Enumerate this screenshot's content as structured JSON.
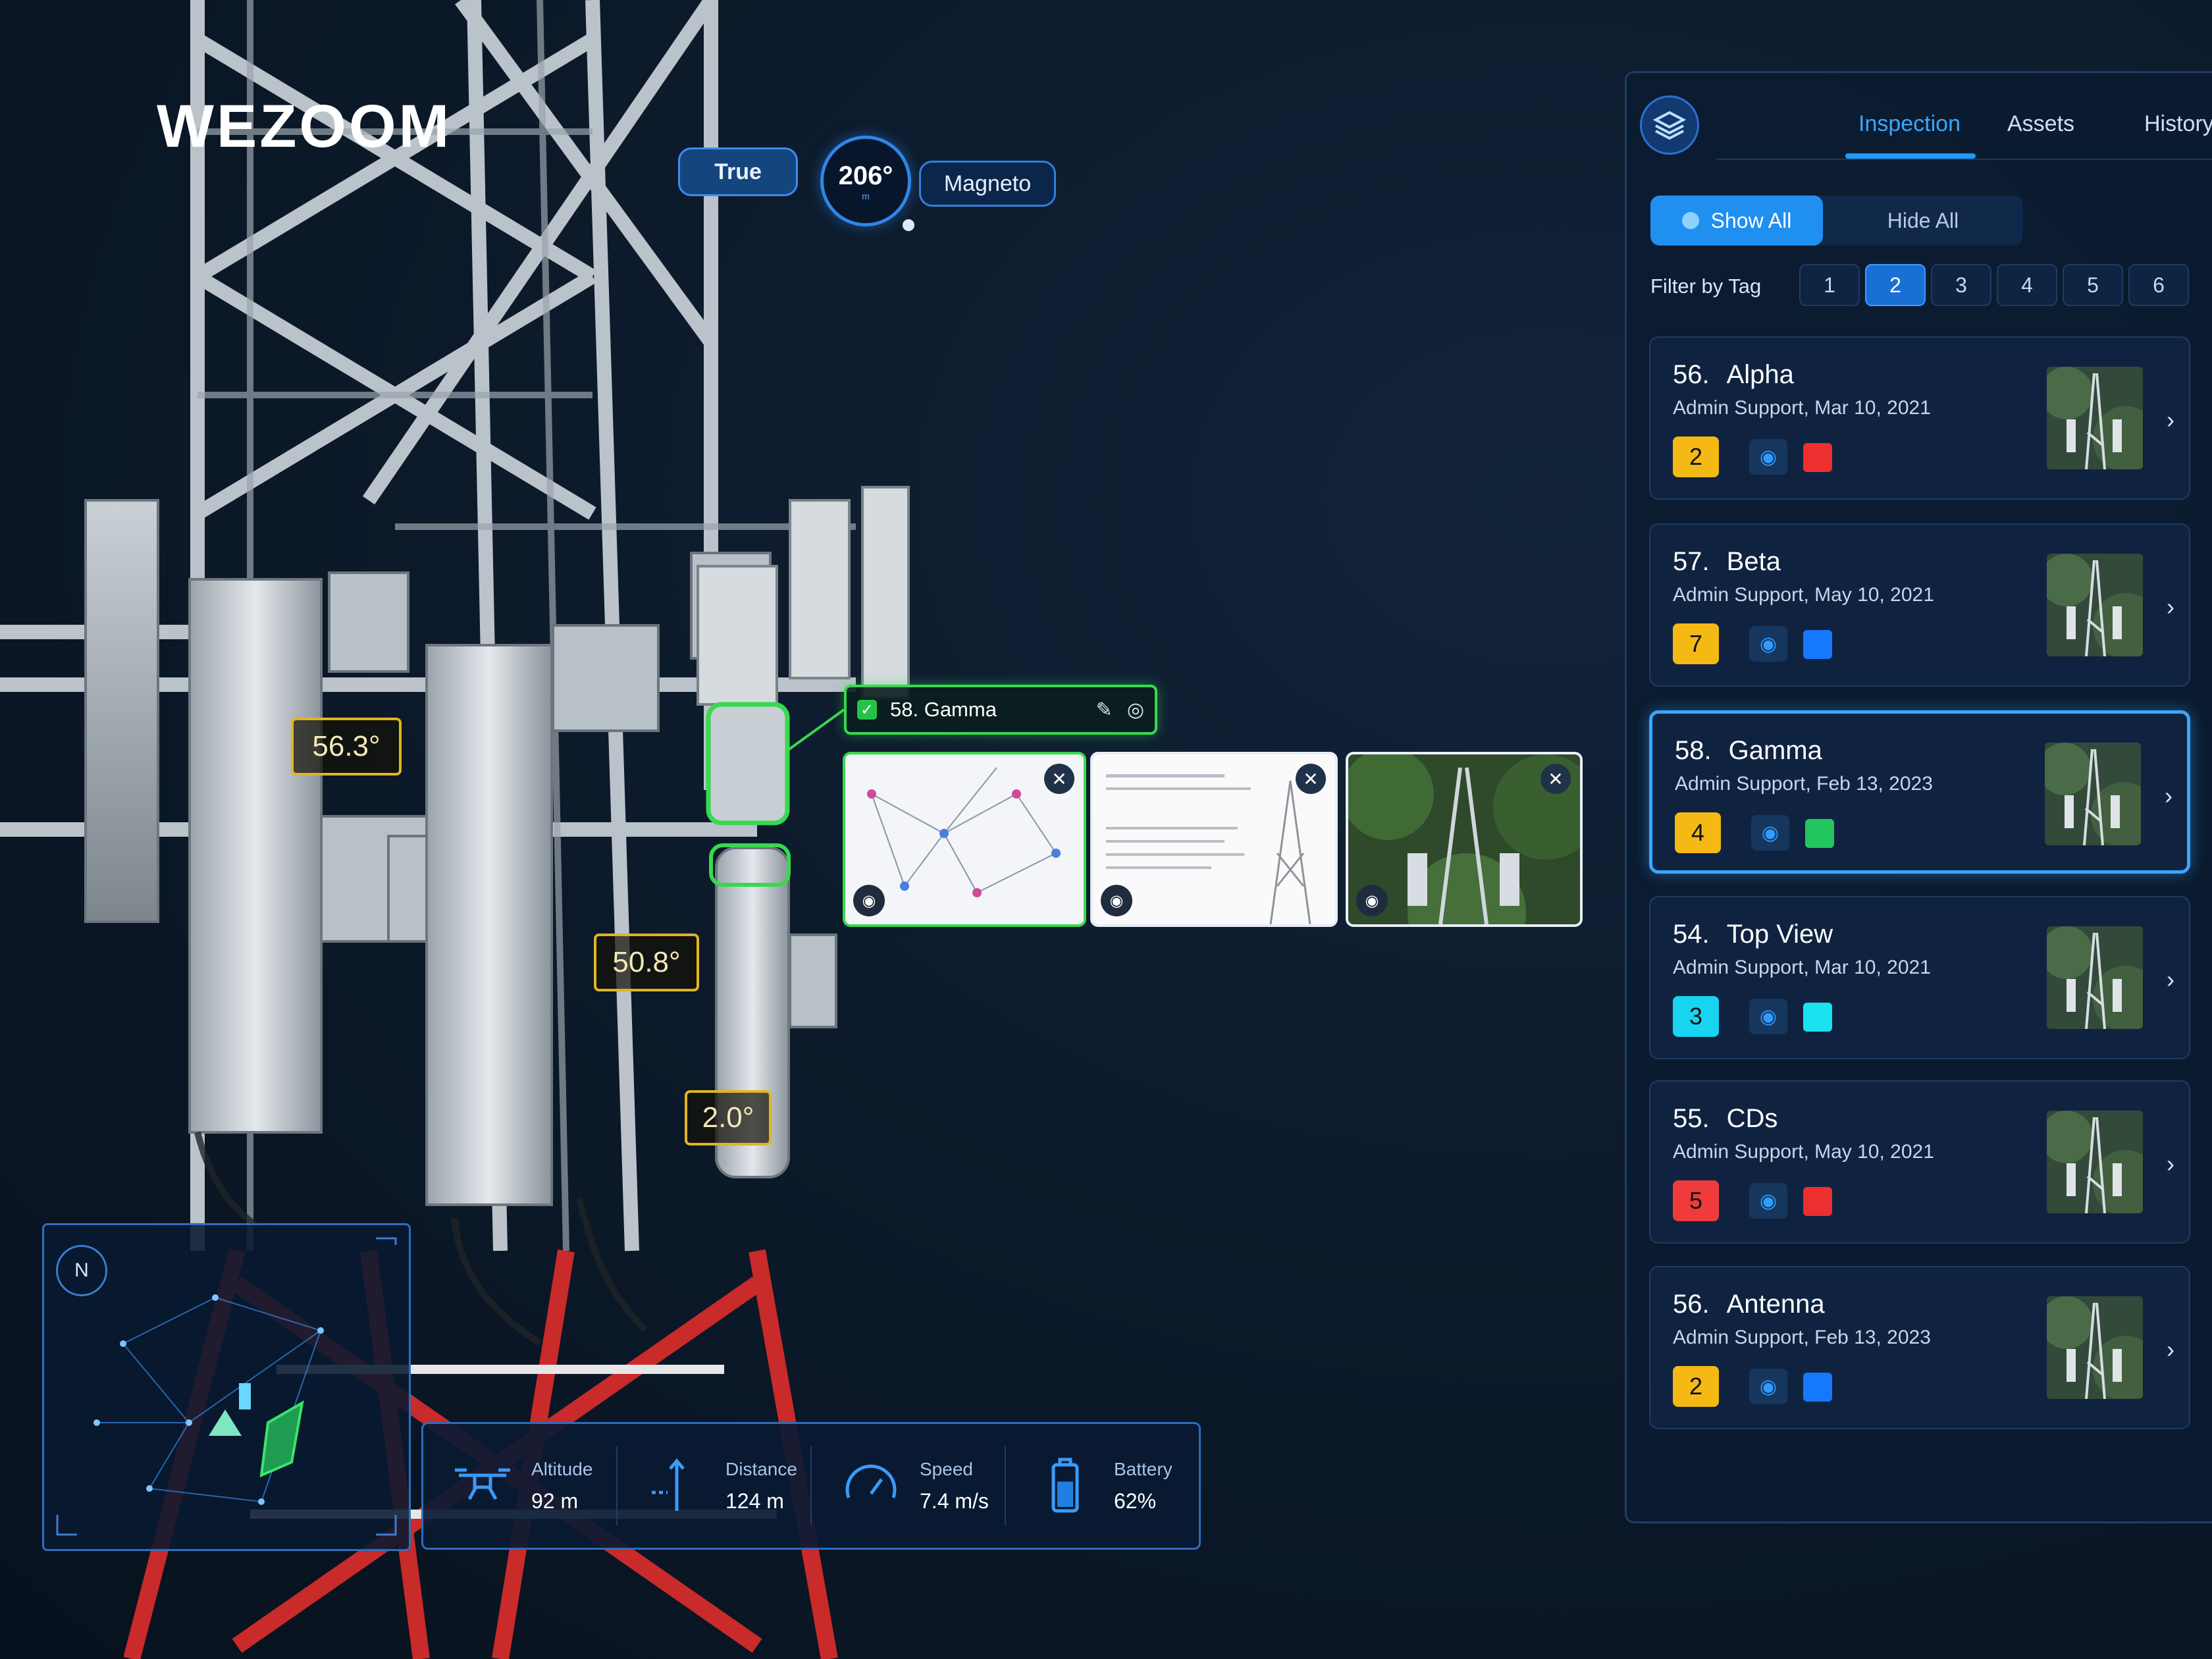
{
  "brand": {
    "logo": "WEZOOM"
  },
  "compass": {
    "true_label": "True",
    "heading": "206°",
    "unit": "m",
    "magneto_label": "Magneto"
  },
  "angles": [
    "56.3°",
    "50.8°",
    "2.0°"
  ],
  "selected_tag": {
    "label": "58. Gamma"
  },
  "minimap": {
    "north": "N"
  },
  "telemetry": [
    {
      "label": "Altitude",
      "value": "92 m",
      "icon": "drone-icon"
    },
    {
      "label": "Distance",
      "value": "124 m",
      "icon": "distance-icon"
    },
    {
      "label": "Speed",
      "value": "7.4 m/s",
      "icon": "speedometer-icon"
    },
    {
      "label": "Battery",
      "value": "62%",
      "icon": "battery-icon",
      "level": 0.62
    }
  ],
  "panel": {
    "tabs": [
      "Inspection",
      "Assets",
      "History"
    ],
    "active_tab": "Inspection",
    "show_all": "Show All",
    "hide_all": "Hide All",
    "filter_label": "Filter by Tag",
    "filter_tags": [
      "1",
      "2",
      "3",
      "4",
      "5",
      "6"
    ],
    "active_filter": "2",
    "items": [
      {
        "num": "56.",
        "name": "Alpha",
        "sub": "Admin Support, Mar 10, 2021",
        "badge": "2",
        "badge_color": "#f5b915",
        "color": "#ee2f2f",
        "selected": false
      },
      {
        "num": "57.",
        "name": "Beta",
        "sub": "Admin Support, May 10, 2021",
        "badge": "7",
        "badge_color": "#f5b915",
        "color": "#1677ff",
        "selected": false
      },
      {
        "num": "58.",
        "name": "Gamma",
        "sub": "Admin Support, Feb 13, 2023",
        "badge": "4",
        "badge_color": "#f5b915",
        "color": "#22c55e",
        "selected": true
      },
      {
        "num": "54.",
        "name": "Top View",
        "sub": "Admin Support, Mar 10, 2021",
        "badge": "3",
        "badge_color": "#19d4f0",
        "color": "#19e3f0",
        "selected": false
      },
      {
        "num": "55.",
        "name": "CDs",
        "sub": "Admin Support, May 10, 2021",
        "badge": "5",
        "badge_color": "#ef3b3b",
        "color": "#ee2f2f",
        "selected": false
      },
      {
        "num": "56.",
        "name": "Antenna",
        "sub": "Admin Support, Feb 13, 2023",
        "badge": "2",
        "badge_color": "#f5b915",
        "color": "#1677ff",
        "selected": false
      }
    ]
  }
}
